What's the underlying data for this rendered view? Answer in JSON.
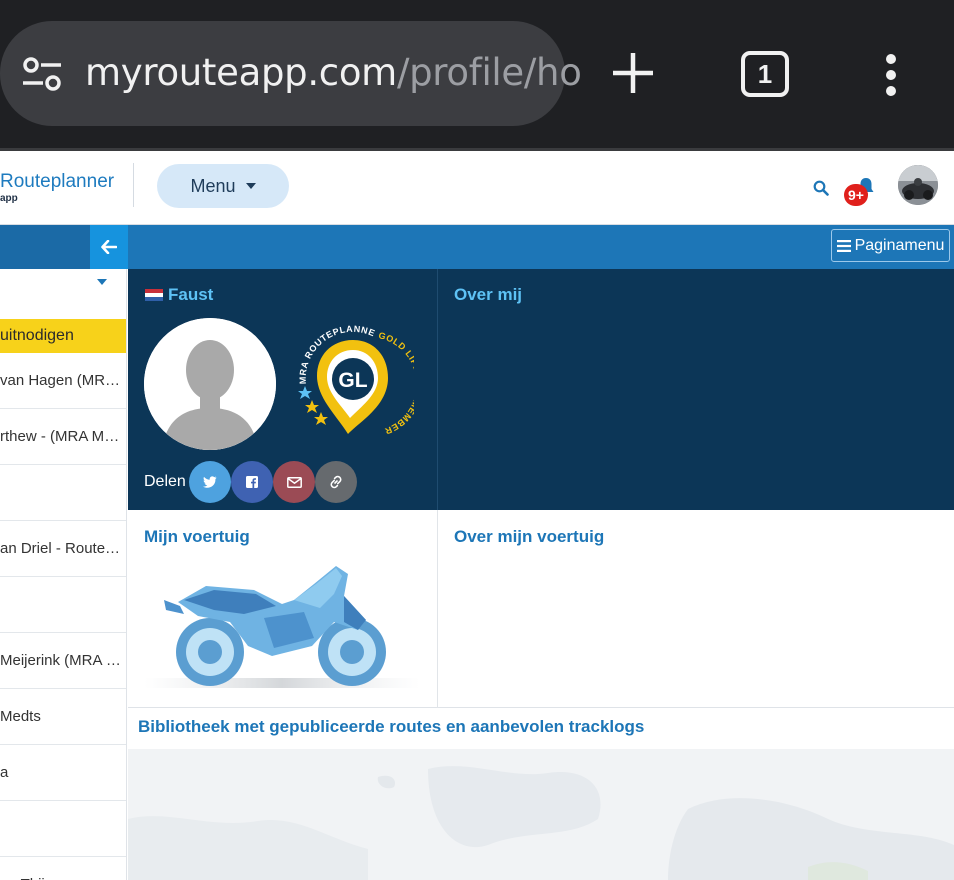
{
  "browser": {
    "url_host": "myrouteapp.com",
    "url_path": "/profile/ho",
    "tab_count": "1"
  },
  "header": {
    "brand_name": "Routeplanner",
    "brand_sub": "app",
    "menu_label": "Menu",
    "notification_count": "9+"
  },
  "toolbar": {
    "page_menu_label": "Paginamenu"
  },
  "sidebar": {
    "invite_label": "uitnodigen",
    "items": [
      "van Hagen (MRA Routeplanner)",
      "rthew - (MRA Master)",
      "",
      "an Driel - Routeplanner",
      "",
      "Meijerink (MRA Master)",
      " Medts",
      "a",
      "",
      "an Thijs"
    ]
  },
  "profile": {
    "name": "Faust",
    "about_heading": "Over mij",
    "badge_initials": "GL",
    "badge_top_text": "MRA ROUTEPLANNER",
    "badge_side_text": "GOLD LIFETIME MEMBER",
    "share_label": "Delen"
  },
  "vehicle": {
    "heading": "Mijn voertuig",
    "about_heading": "Over mijn voertuig"
  },
  "library": {
    "heading": "Bibliotheek met gepubliceerde routes en aanbevolen tracklogs"
  },
  "colors": {
    "chrome_bg": "#1f2023",
    "urlbar_bg": "#3c3d41",
    "toolbar_blue": "#1d76b7",
    "profile_panel": "#0c3657",
    "accent_light_blue": "#5ec2f5",
    "invite_yellow": "#f7d21a",
    "badge_red": "#e0201c",
    "twitter": "#4ea2df",
    "facebook": "#3f62b2",
    "email": "#9b4b55",
    "link": "#666a6e"
  },
  "icons": {
    "site_info": "tune-icon",
    "new_tab": "plus-icon",
    "tabs": "tabs-icon",
    "overflow": "kebab-menu-icon",
    "search": "search-icon",
    "notifications": "bell-icon",
    "back": "arrow-left-icon",
    "page_menu": "hamburger-icon",
    "share": [
      "twitter-icon",
      "facebook-icon",
      "email-icon",
      "link-icon"
    ]
  }
}
